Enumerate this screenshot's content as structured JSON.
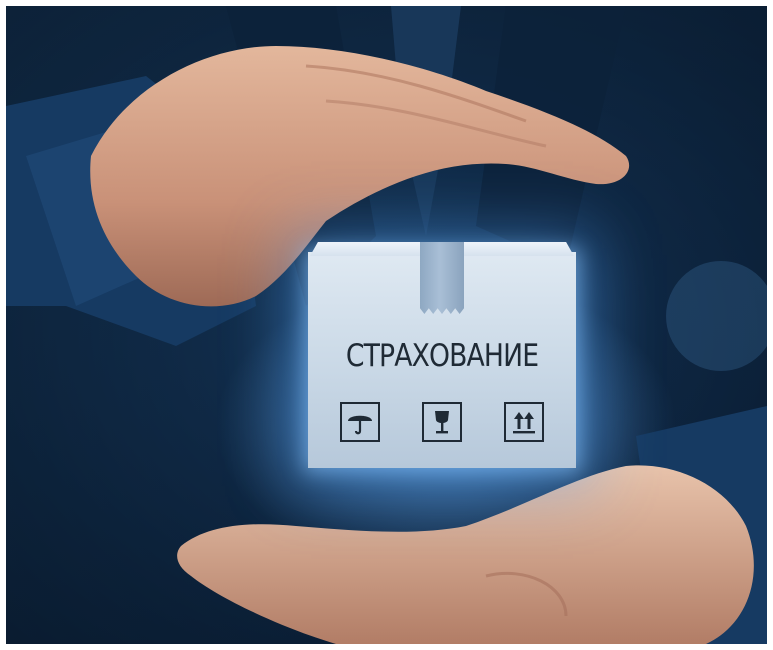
{
  "image": {
    "box_label": "СТРАХОВАНИЕ",
    "handling_icons": [
      "umbrella-icon",
      "fragile-glass-icon",
      "this-way-up-icon"
    ],
    "colors": {
      "background_dark": "#07182d",
      "background_mid": "#1d4a78",
      "glow": "#5aaaff",
      "box": "#c9d8e6",
      "text": "#1f2a35"
    }
  }
}
